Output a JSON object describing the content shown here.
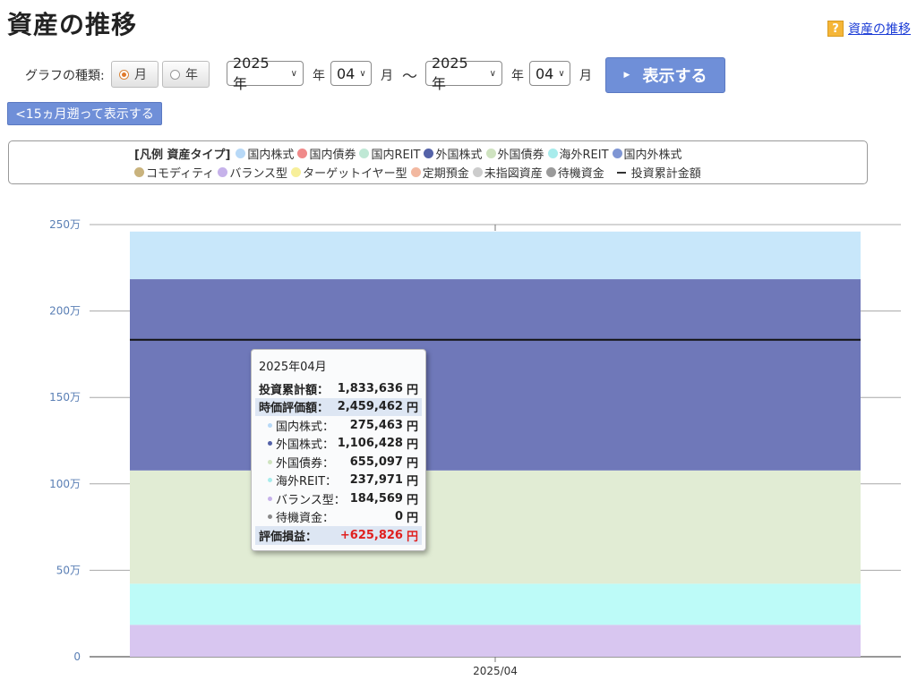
{
  "page": {
    "title": "資産の推移",
    "help_link": "資産の推移",
    "help_icon": "?"
  },
  "controls": {
    "graph_type_label": "グラフの種類:",
    "radio_month": "月",
    "radio_year": "年",
    "selected_type": "月",
    "start_year": "2025 年",
    "start_year_unit": "年",
    "start_month": "04",
    "start_month_unit": "月",
    "range_sep": "〜",
    "end_year": "2025 年",
    "end_year_unit": "年",
    "end_month": "04",
    "end_month_unit": "月",
    "show_button": "表示する",
    "back_button": "<15ヵ月遡って表示する"
  },
  "legend": {
    "title": "[凡例 資産タイプ]",
    "items": [
      {
        "label": "国内株式",
        "color": "#b8d9f7"
      },
      {
        "label": "国内債券",
        "color": "#f08a8a"
      },
      {
        "label": "国内REIT",
        "color": "#bfe8d5"
      },
      {
        "label": "外国株式",
        "color": "#5462a8"
      },
      {
        "label": "外国債券",
        "color": "#cfe3c0"
      },
      {
        "label": "海外REIT",
        "color": "#a8ecec"
      },
      {
        "label": "国内外株式",
        "color": "#7f96d4"
      },
      {
        "label": "コモディティ",
        "color": "#c9b37d"
      },
      {
        "label": "バランス型",
        "color": "#c6b2ea"
      },
      {
        "label": "ターゲットイヤー型",
        "color": "#f7ef9a"
      },
      {
        "label": "定期預金",
        "color": "#f2b8a0"
      },
      {
        "label": "未指図資産",
        "color": "#cccccc"
      },
      {
        "label": "待機資金",
        "color": "#9a9a9a"
      }
    ],
    "line_label": "投資累計金額"
  },
  "chart_data": {
    "type": "bar",
    "stacked": true,
    "categories": [
      "2025/04"
    ],
    "series": [
      {
        "name": "バランス型",
        "values": [
          184569
        ],
        "color": "#d8c6f0"
      },
      {
        "name": "海外REIT",
        "values": [
          237971
        ],
        "color": "#bdfbf8"
      },
      {
        "name": "外国債券",
        "values": [
          655097
        ],
        "color": "#e1ecd4"
      },
      {
        "name": "外国株式",
        "values": [
          1106428
        ],
        "color": "#6f78b9"
      },
      {
        "name": "国内株式",
        "values": [
          275463
        ],
        "color": "#c8e7fa"
      },
      {
        "name": "待機資金",
        "values": [
          0
        ],
        "color": "#9a9a9a"
      }
    ],
    "line": {
      "name": "投資累計金額",
      "values": [
        1833636
      ],
      "color": "#111111"
    },
    "ylim": [
      0,
      2500000
    ],
    "yticks": [
      0,
      500000,
      1000000,
      1500000,
      2000000,
      2500000
    ],
    "ytick_labels": [
      "0",
      "50万",
      "100万",
      "150万",
      "200万",
      "250万"
    ],
    "grid": true
  },
  "tooltip": {
    "period": "2025年04月",
    "rows": [
      {
        "label": "投資累計額：",
        "value": "1,833,636",
        "unit": "円",
        "style": "bold"
      },
      {
        "label": "時価評価額：",
        "value": "2,459,462",
        "unit": "円",
        "style": "bold-shade"
      },
      {
        "label": "国内株式：",
        "value": "275,463",
        "unit": "円",
        "dot": "#b8d9f7"
      },
      {
        "label": "外国株式：",
        "value": "1,106,428",
        "unit": "円",
        "dot": "#5462a8"
      },
      {
        "label": "外国債券：",
        "value": "655,097",
        "unit": "円",
        "dot": "#cfe3c0"
      },
      {
        "label": "海外REIT：",
        "value": "237,971",
        "unit": "円",
        "dot": "#a8ecec"
      },
      {
        "label": "バランス型：",
        "value": "184,569",
        "unit": "円",
        "dot": "#c6b2ea"
      },
      {
        "label": "待機資金：",
        "value": "0",
        "unit": "円",
        "dot": "#8a8a8a"
      },
      {
        "label": "評価損益：",
        "value": "+625,826",
        "unit": "円",
        "style": "bold-shade-red"
      }
    ]
  }
}
